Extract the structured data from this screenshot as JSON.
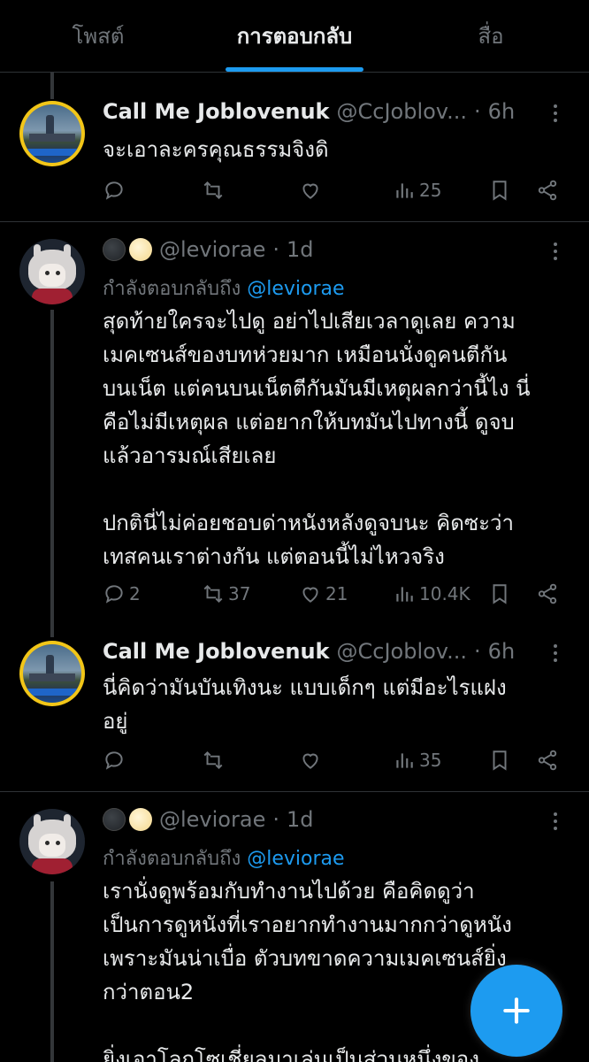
{
  "tabs": [
    {
      "label": "โพสต์",
      "active": false
    },
    {
      "label": "การตอบกลับ",
      "active": true
    },
    {
      "label": "สื่อ",
      "active": false
    }
  ],
  "accent_color": "#1d9bf0",
  "tweets": [
    {
      "name": "Call Me Joblovenuk",
      "handle": "@CcJoblov...",
      "time": "6h",
      "text": "จะเอาละครคุณธรรมจิงดิ",
      "replies": "",
      "retweets": "",
      "likes": "",
      "views": "25"
    },
    {
      "name": "",
      "handle": "@leviorae",
      "time": "1d",
      "replying_to_label": "กำลังตอบกลับถึง",
      "replying_to_handle": "@leviorae",
      "text": "สุดท้ายใครจะไปดู อย่าไปเสียเวลาดูเลย ความ\nเมคเซนส์ของบทห่วยมาก เหมือนนั่งดูคนตีกัน\nบนเน็ต แต่คนบนเน็ตตีกันมันมีเหตุผลกว่านี้ไง นี่\nคือไม่มีเหตุผล แต่อยากให้บทมันไปทางนี้ ดูจบ\nแล้วอารมณ์เสียเลย\n\nปกตินี่ไม่ค่อยชอบด่าหนังหลังดูจบนะ คิดซะว่า\nเทสคนเราต่างกัน แต่ตอนนี้ไม่ไหวจริง",
      "replies": "2",
      "retweets": "37",
      "likes": "21",
      "views": "10.4K"
    },
    {
      "name": "Call Me Joblovenuk",
      "handle": "@CcJoblov...",
      "time": "6h",
      "text": "นี่คิดว่ามันบันเทิงนะ แบบเด็กๆ แต่มีอะไรแฝง\nอยู่",
      "replies": "",
      "retweets": "",
      "likes": "",
      "views": "35"
    },
    {
      "name": "",
      "handle": "@leviorae",
      "time": "1d",
      "replying_to_label": "กำลังตอบกลับถึง",
      "replying_to_handle": "@leviorae",
      "text": "เรานั่งดูพร้อมกับทำงานไปด้วย คือคิดดูว่า\nเป็นการดูหนังที่เราอยากทำงานมากกว่าดูหนัง\nเพราะมันน่าเบื่อ ตัวบทขาดความเมคเซนส์ยิ่ง\nกว่าตอน2\n\nยิ่งเอาโลกโซเชี่ยลมาเล่นเป็นส่วนหนึ่งของ"
    }
  ],
  "dot_separator": "·",
  "icons": {
    "reply": "reply-icon",
    "retweet": "retweet-icon",
    "like": "heart-icon",
    "views": "views-icon",
    "bookmark": "bookmark-icon",
    "share": "share-icon",
    "compose": "plus-icon"
  }
}
